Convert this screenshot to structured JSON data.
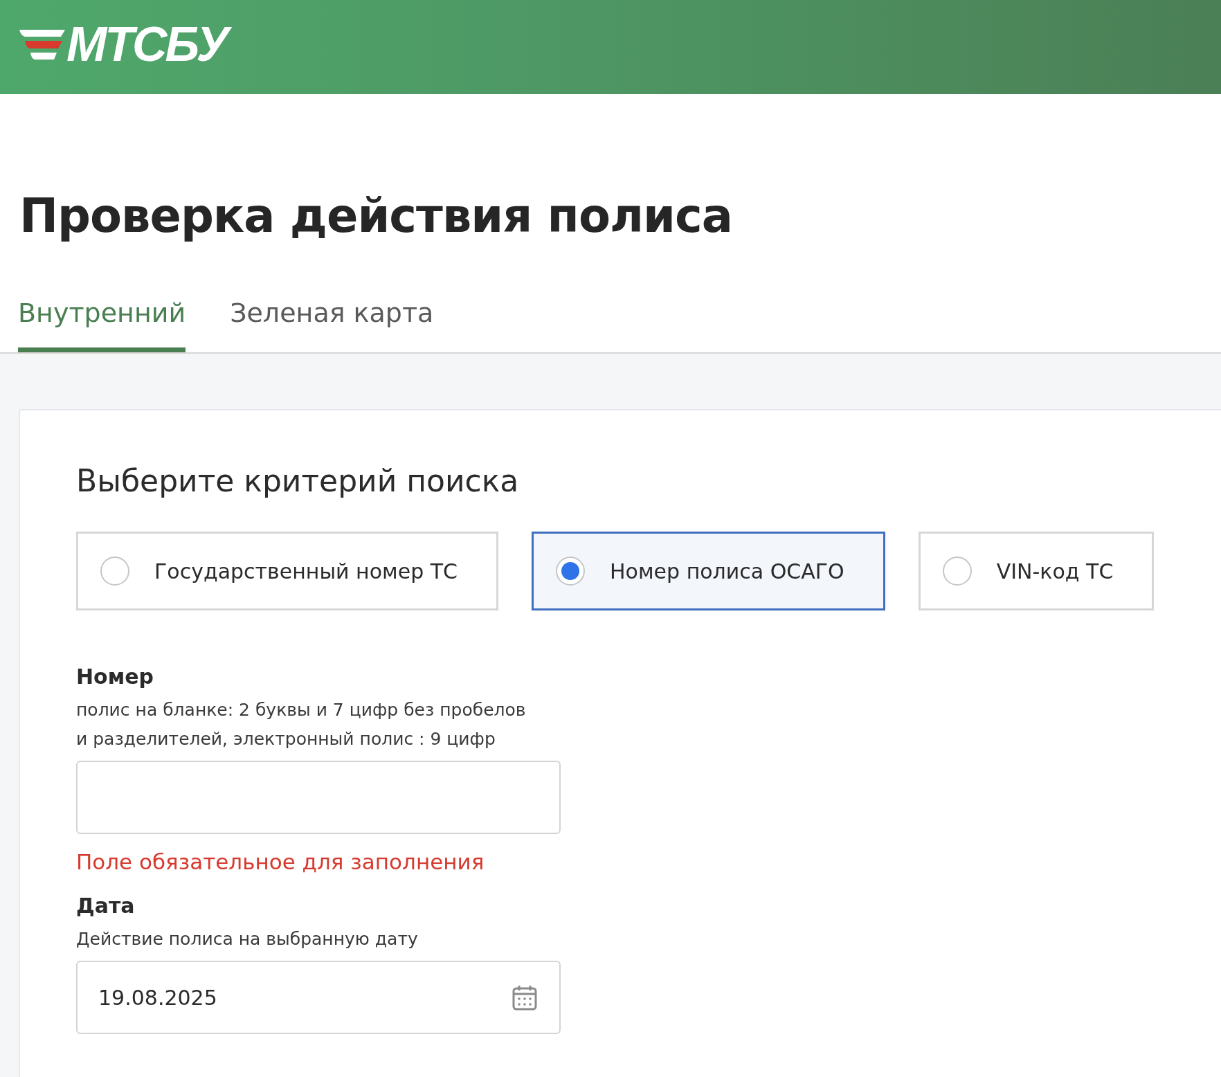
{
  "header": {
    "logo_text": "МТСБУ"
  },
  "page_title": "Проверка действия полиса",
  "tabs": [
    {
      "label": "Внутренний",
      "selected": true
    },
    {
      "label": "Зеленая карта",
      "selected": false
    }
  ],
  "form": {
    "heading": "Выберите критерий поиска",
    "criteria": [
      {
        "label": "Государственный номер ТС",
        "selected": false
      },
      {
        "label": "Номер полиса ОСАГО",
        "selected": true
      },
      {
        "label": "VIN-код ТС",
        "selected": false
      }
    ],
    "fields": [
      {
        "kind": "text",
        "label": "Номер",
        "hint_lines": [
          "полис на бланке: 2 буквы и 7 цифр без пробелов",
          "и разделителей, электронный полис : 9 цифр"
        ],
        "error": "Поле обязательное для заполнения"
      },
      {
        "kind": "date",
        "label": "Дата",
        "hint_lines": [
          "Действие полиса на выбранную дату"
        ],
        "value": "19.08.2025"
      }
    ]
  }
}
